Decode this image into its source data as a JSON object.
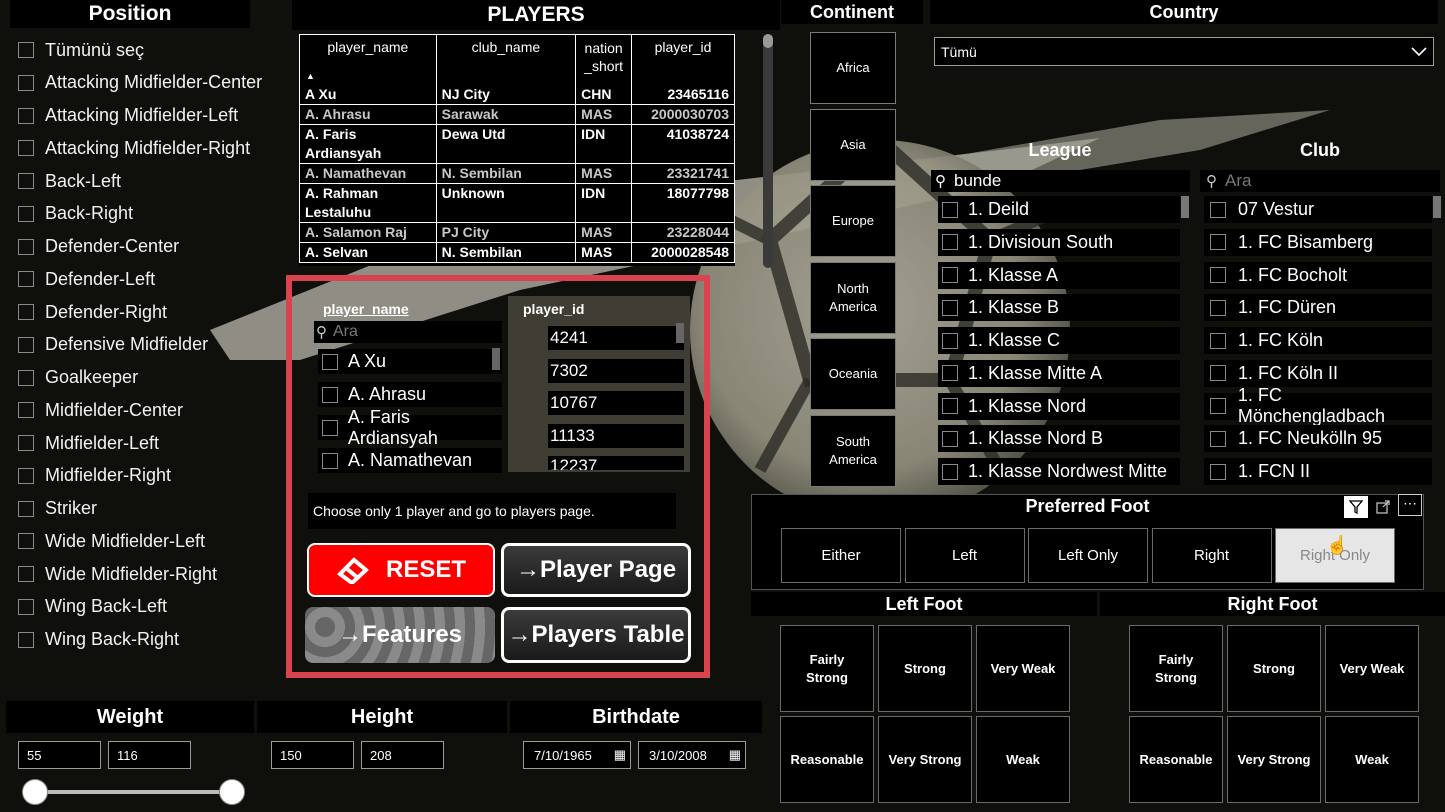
{
  "position": {
    "title": "Position",
    "items": [
      "Tümünü seç",
      "Attacking Midfielder-Center",
      "Attacking Midfielder-Left",
      "Attacking Midfielder-Right",
      "Back-Left",
      "Back-Right",
      "Defender-Center",
      "Defender-Left",
      "Defender-Right",
      "Defensive Midfielder",
      "Goalkeeper",
      "Midfielder-Center",
      "Midfielder-Left",
      "Midfielder-Right",
      "Striker",
      "Wide Midfielder-Left",
      "Wide Midfielder-Right",
      "Wing Back-Left",
      "Wing Back-Right"
    ]
  },
  "players": {
    "title": "PLAYERS",
    "columns": [
      "player_name",
      "club_name",
      "nation\n_short",
      "player_id"
    ],
    "rows": [
      [
        "A Xu",
        "NJ City",
        "CHN",
        "23465116"
      ],
      [
        "A. Ahrasu",
        "Sarawak",
        "MAS",
        "2000030703"
      ],
      [
        "A. Faris Ardiansyah",
        "Dewa Utd",
        "IDN",
        "41038724"
      ],
      [
        "A. Namathevan",
        "N. Sembilan",
        "MAS",
        "23321741"
      ],
      [
        "A. Rahman Lestaluhu",
        "Unknown",
        "IDN",
        "18077798"
      ],
      [
        "A. Salamon Raj",
        "PJ City",
        "MAS",
        "23228044"
      ],
      [
        "A. Selvan",
        "N. Sembilan",
        "MAS",
        "2000028548"
      ]
    ]
  },
  "selector": {
    "player_name_header": "player_name",
    "search_placeholder": "Ara",
    "names": [
      "A Xu",
      "A. Ahrasu",
      "A. Faris Ardiansyah",
      "A. Namathevan"
    ],
    "player_id_header": "player_id",
    "ids": [
      "4241",
      "7302",
      "10767",
      "11133",
      "12237"
    ],
    "hint": "Choose only 1 player and go to players page.",
    "reset_label": "RESET",
    "player_page_label": "→Player Page",
    "features_label": "→Features",
    "players_table_label": "→Players Table"
  },
  "continent": {
    "title": "Continent",
    "items": [
      "Africa",
      "Asia",
      "Europe",
      "North America",
      "Oceania",
      "South America"
    ]
  },
  "country": {
    "title": "Country",
    "selected": "Tümü"
  },
  "league": {
    "title": "League",
    "search_value": "bunde",
    "items": [
      "1. Deild",
      "1. Divisioun South",
      "1. Klasse A",
      "1. Klasse B",
      "1. Klasse C",
      "1. Klasse Mitte A",
      "1. Klasse Nord",
      "1. Klasse Nord B",
      "1. Klasse Nordwest Mitte"
    ]
  },
  "club": {
    "title": "Club",
    "search_placeholder": "Ara",
    "items": [
      "07 Vestur",
      "1. FC Bisamberg",
      "1. FC Bocholt",
      "1. FC Düren",
      "1. FC Köln",
      "1. FC Köln II",
      "1. FC Mönchengladbach",
      "1. FC Neukölln 95",
      "1. FCN II"
    ]
  },
  "preferred_foot": {
    "title": "Preferred Foot",
    "options": [
      "Either",
      "Left",
      "Left Only",
      "Right",
      "Right Only"
    ],
    "selected": "Right Only"
  },
  "left_foot": {
    "title": "Left Foot",
    "options": [
      "Fairly Strong",
      "Strong",
      "Very Weak",
      "Reasonable",
      "Very Strong",
      "Weak"
    ]
  },
  "right_foot": {
    "title": "Right Foot",
    "options": [
      "Fairly Strong",
      "Strong",
      "Very Weak",
      "Reasonable",
      "Very Strong",
      "Weak"
    ]
  },
  "weight": {
    "title": "Weight",
    "min": "55",
    "max": "116"
  },
  "height": {
    "title": "Height",
    "min": "150",
    "max": "208"
  },
  "birthdate": {
    "title": "Birthdate",
    "from": "7/10/1965",
    "to": "3/10/2008"
  },
  "colors": {
    "highlight_border": "#d9434f",
    "reset_red": "#ff0000",
    "selected_tile": "#e6e6e6"
  }
}
